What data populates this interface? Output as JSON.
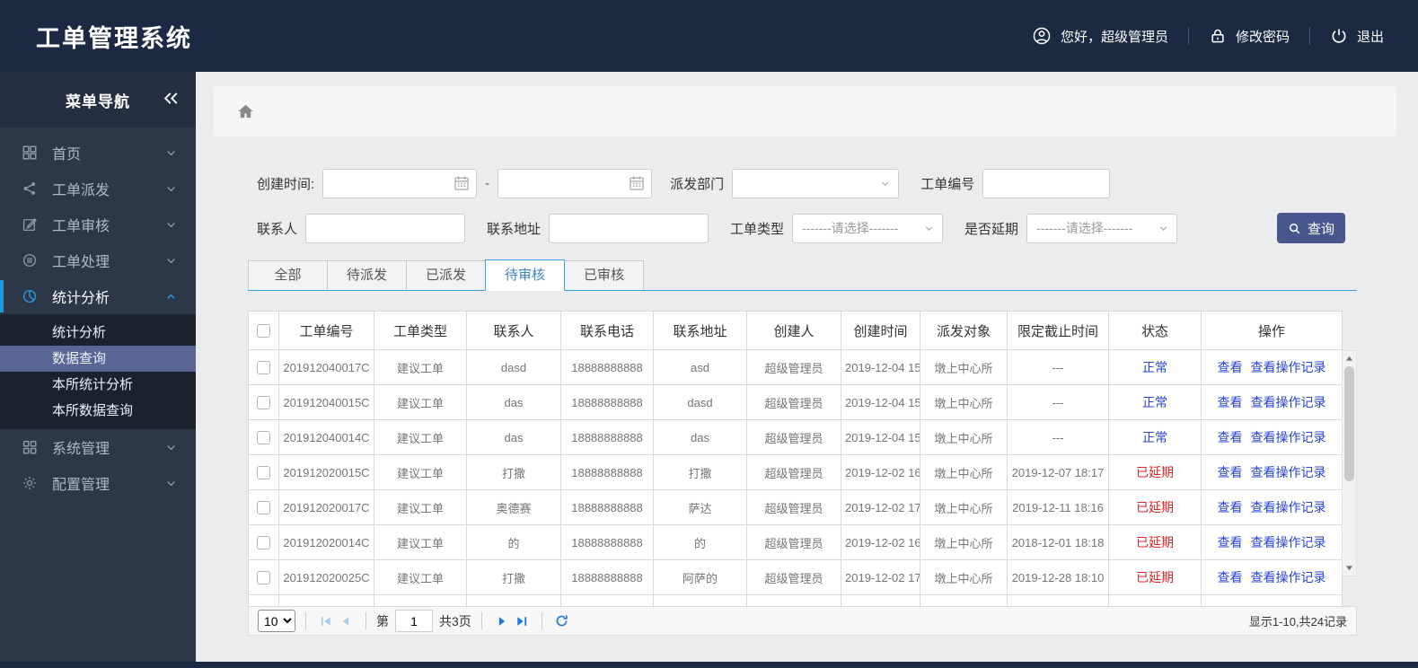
{
  "header": {
    "title": "工单管理系统",
    "greeting": "您好，超级管理员",
    "change_password": "修改密码",
    "logout": "退出"
  },
  "sidebar": {
    "title": "菜单导航",
    "items": [
      {
        "key": "home",
        "label": "首页",
        "icon": "grid"
      },
      {
        "key": "dispatch",
        "label": "工单派发",
        "icon": "share"
      },
      {
        "key": "review",
        "label": "工单审核",
        "icon": "edit"
      },
      {
        "key": "process",
        "label": "工单处理",
        "icon": "layers"
      },
      {
        "key": "stats",
        "label": "统计分析",
        "icon": "pie",
        "active": true,
        "children": [
          {
            "key": "stats-analysis",
            "label": "统计分析"
          },
          {
            "key": "data-query",
            "label": "数据查询",
            "selected": true
          },
          {
            "key": "branch-stats",
            "label": "本所统计分析"
          },
          {
            "key": "branch-query",
            "label": "本所数据查询"
          }
        ]
      },
      {
        "key": "system",
        "label": "系统管理",
        "icon": "apps"
      },
      {
        "key": "config",
        "label": "配置管理",
        "icon": "gear"
      }
    ]
  },
  "filters": {
    "create_time_label": "创建时间:",
    "range_separator": "-",
    "depart_label": "派发部门",
    "order_no_label": "工单编号",
    "contact_label": "联系人",
    "address_label": "联系地址",
    "type_label": "工单类型",
    "delay_label": "是否延期",
    "select_placeholder": "-------请选择-------",
    "search_button": "查询"
  },
  "tabs": {
    "active_index": 3,
    "items": [
      {
        "key": "all",
        "label": "全部"
      },
      {
        "key": "pending-dispatch",
        "label": "待派发"
      },
      {
        "key": "dispatched",
        "label": "已派发"
      },
      {
        "key": "pending-review",
        "label": "待审核"
      },
      {
        "key": "reviewed",
        "label": "已审核"
      }
    ]
  },
  "table": {
    "columns": [
      "工单编号",
      "工单类型",
      "联系人",
      "联系电话",
      "联系地址",
      "创建人",
      "创建时间",
      "派发对象",
      "限定截止时间",
      "状态",
      "操作"
    ],
    "action_labels": [
      "查看",
      "查看操作记录"
    ],
    "status_colors": {
      "正常": "#2945d0",
      "已延期": "#e02525"
    },
    "partial_row_visible": true,
    "rows": [
      {
        "order_id": "201912040017C",
        "type": "建议工单",
        "contact": "dasd",
        "phone": "18888888888",
        "address": "asd",
        "creator": "超级管理员",
        "created": "2019-12-04 15",
        "target": "墩上中心所",
        "deadline": "---",
        "status": "正常"
      },
      {
        "order_id": "201912040015C",
        "type": "建议工单",
        "contact": "das",
        "phone": "18888888888",
        "address": "dasd",
        "creator": "超级管理员",
        "created": "2019-12-04 15",
        "target": "墩上中心所",
        "deadline": "---",
        "status": "正常"
      },
      {
        "order_id": "201912040014C",
        "type": "建议工单",
        "contact": "das",
        "phone": "18888888888",
        "address": "das",
        "creator": "超级管理员",
        "created": "2019-12-04 15",
        "target": "墩上中心所",
        "deadline": "---",
        "status": "正常"
      },
      {
        "order_id": "201912020015C",
        "type": "建议工单",
        "contact": "打撒",
        "phone": "18888888888",
        "address": "打撒",
        "creator": "超级管理员",
        "created": "2019-12-02 16",
        "target": "墩上中心所",
        "deadline": "2019-12-07 18:17",
        "status": "已延期"
      },
      {
        "order_id": "201912020017C",
        "type": "建议工单",
        "contact": "奥德赛",
        "phone": "18888888888",
        "address": "萨达",
        "creator": "超级管理员",
        "created": "2019-12-02 17",
        "target": "墩上中心所",
        "deadline": "2019-12-11 18:16",
        "status": "已延期"
      },
      {
        "order_id": "201912020014C",
        "type": "建议工单",
        "contact": "的",
        "phone": "18888888888",
        "address": "的",
        "creator": "超级管理员",
        "created": "2019-12-02 16",
        "target": "墩上中心所",
        "deadline": "2018-12-01 18:18",
        "status": "已延期"
      },
      {
        "order_id": "201912020025C",
        "type": "建议工单",
        "contact": "打撒",
        "phone": "18888888888",
        "address": "阿萨的",
        "creator": "超级管理员",
        "created": "2019-12-02 17",
        "target": "墩上中心所",
        "deadline": "2019-12-28 18:10",
        "status": "已延期"
      }
    ]
  },
  "pagination": {
    "page_size": "10",
    "page_label_prefix": "第",
    "page_value": "1",
    "page_label_suffix": "共3页",
    "summary": "显示1-10,共24记录"
  }
}
